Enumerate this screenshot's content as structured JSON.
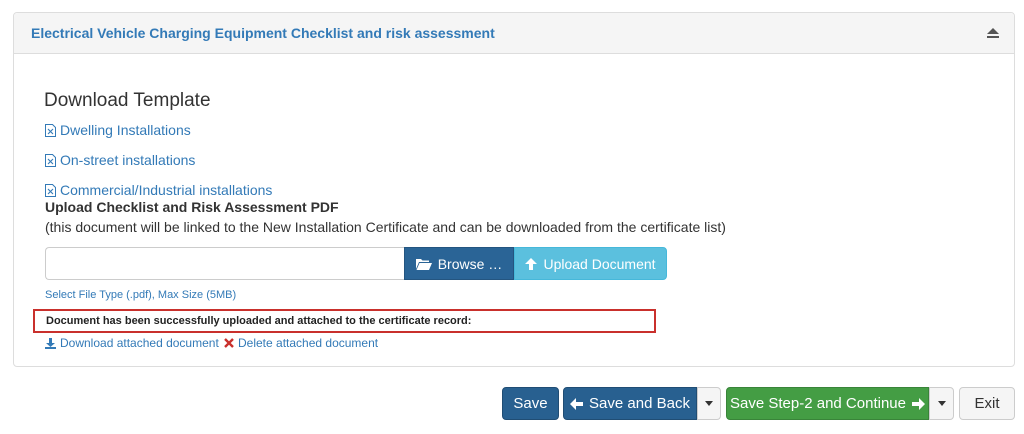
{
  "panel": {
    "title": "Electrical Vehicle Charging Equipment Checklist and risk assessment"
  },
  "templates": {
    "heading": "Download Template",
    "links": [
      {
        "label": "Dwelling Installations",
        "icon": "excel-file-icon"
      },
      {
        "label": "On-street installations",
        "icon": "excel-file-icon"
      },
      {
        "label": "Commercial/Industrial installations",
        "icon": "excel-file-icon"
      }
    ]
  },
  "upload": {
    "title": "Upload Checklist and Risk Assessment PDF",
    "description": "(this document will be linked to the New Installation Certificate and can be downloaded from the certificate list)",
    "file_value": "",
    "file_placeholder": "",
    "browse_label": "Browse …",
    "upload_label": "Upload Document",
    "hint": "Select File Type (.pdf), Max Size (5MB)",
    "success_message": "Document has been successfully uploaded and attached to the certificate record:",
    "download_label": "Download attached document",
    "delete_label": "Delete attached document"
  },
  "footer": {
    "save_label": "Save",
    "save_back_label": "Save and Back",
    "continue_label": "Save Step-2 and Continue",
    "exit_label": "Exit"
  },
  "colors": {
    "link": "#337ab7",
    "primary": "#286090",
    "info": "#5bc0de",
    "success": "#449d44",
    "danger": "#c9302c"
  }
}
